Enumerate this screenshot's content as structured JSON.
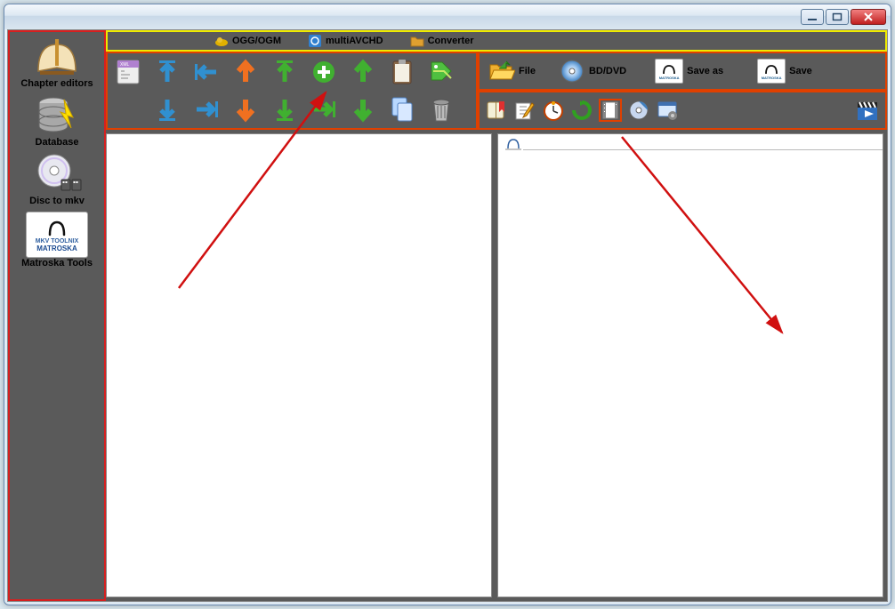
{
  "window": {
    "title": ""
  },
  "sidebar": {
    "items": [
      {
        "label": "Chapter editors",
        "icon": "book-icon"
      },
      {
        "label": "Database",
        "icon": "database-icon"
      },
      {
        "label": "Disc to mkv",
        "icon": "disc-icon"
      },
      {
        "label": "Matroska Tools",
        "icon": "matroska-icon"
      }
    ]
  },
  "menubar": {
    "items": [
      {
        "label": "OGG/OGM",
        "icon": "cloud-icon"
      },
      {
        "label": "multiAVCHD",
        "icon": "blue-box-icon"
      },
      {
        "label": "Converter",
        "icon": "folder-gold-icon"
      }
    ]
  },
  "toolbar_left": {
    "row1": [
      {
        "name": "xml-doc-icon"
      },
      {
        "name": "top-up-blue-icon"
      },
      {
        "name": "left-most-blue-icon"
      },
      {
        "name": "up-orange-icon"
      },
      {
        "name": "top-green-icon"
      },
      {
        "name": "add-green-icon"
      },
      {
        "name": "up-green-icon"
      },
      {
        "name": "clipboard-icon"
      },
      {
        "name": "tag-green-icon"
      }
    ],
    "row2": [
      {
        "name": "down-in-blue-icon"
      },
      {
        "name": "right-most-blue-icon"
      },
      {
        "name": "down-orange-icon"
      },
      {
        "name": "down-in-green-icon"
      },
      {
        "name": "right-end-green-icon"
      },
      {
        "name": "down-green-icon"
      },
      {
        "name": "copy-docs-icon"
      },
      {
        "name": "trash-icon"
      }
    ]
  },
  "toolbar_right_top": {
    "items": [
      {
        "label": "File",
        "icon": "folder-open-icon"
      },
      {
        "label": "BD/DVD",
        "icon": "disc-blue-icon"
      },
      {
        "label": "Save as",
        "icon": "matroska-box-icon"
      },
      {
        "label": "Save",
        "icon": "matroska-box-icon"
      }
    ]
  },
  "toolbar_right_bottom": {
    "items": [
      {
        "name": "book-bookmark-icon"
      },
      {
        "name": "edit-pencil-icon"
      },
      {
        "name": "clock-icon"
      },
      {
        "name": "recycle-green-icon"
      },
      {
        "name": "film-red-icon"
      },
      {
        "name": "disc-small-icon"
      },
      {
        "name": "window-gear-icon"
      }
    ],
    "right_item": {
      "name": "clapper-play-icon"
    }
  },
  "colors": {
    "highlight_box": "#d52020",
    "menubar_box": "#eeea00"
  }
}
